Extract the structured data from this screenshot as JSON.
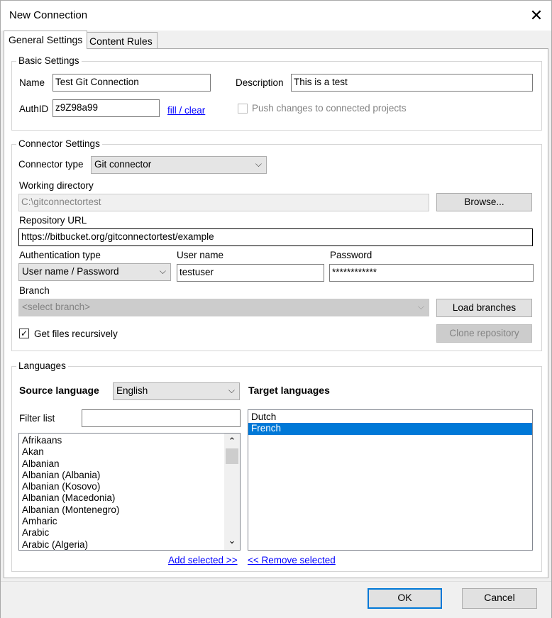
{
  "window": {
    "title": "New Connection",
    "close_glyph": "✕"
  },
  "tabs": [
    {
      "label": "General Settings",
      "active": true
    },
    {
      "label": "Content Rules",
      "active": false
    }
  ],
  "basic": {
    "group_label": "Basic Settings",
    "name_label": "Name",
    "name_value": "Test Git Connection",
    "description_label": "Description",
    "description_value": "This is a test",
    "authid_label": "AuthID",
    "authid_value": "z9Z98a99",
    "fill_clear_link": "fill / clear",
    "push_changes_label": "Push changes to connected projects",
    "push_changes_checked": false
  },
  "connector": {
    "group_label": "Connector Settings",
    "type_label": "Connector type",
    "type_value": "Git connector",
    "workdir_label": "Working directory",
    "workdir_value": "C:\\gitconnectortest",
    "browse_button": "Browse...",
    "repo_label": "Repository URL",
    "repo_value": "https://bitbucket.org/gitconnectortest/example",
    "auth_type_label": "Authentication type",
    "auth_type_value": "User name / Password",
    "username_label": "User name",
    "username_value": "testuser",
    "password_label": "Password",
    "password_value": "************",
    "branch_label": "Branch",
    "branch_value": "<select branch>",
    "load_branches_button": "Load branches",
    "recursive_label": "Get files recursively",
    "recursive_checked": true,
    "clone_button": "Clone repository"
  },
  "languages": {
    "group_label": "Languages",
    "source_label": "Source language",
    "source_value": "English",
    "target_label": "Target languages",
    "filter_label": "Filter list",
    "filter_value": "",
    "source_list": [
      "Afrikaans",
      "Akan",
      "Albanian",
      "Albanian (Albania)",
      "Albanian (Kosovo)",
      "Albanian (Macedonia)",
      "Albanian (Montenegro)",
      "Amharic",
      "Arabic",
      "Arabic (Algeria)"
    ],
    "target_list": [
      "Dutch",
      "French"
    ],
    "target_selected": "French",
    "add_selected_link": "Add selected  >>",
    "remove_selected_link": "<< Remove selected"
  },
  "footer": {
    "ok_button": "OK",
    "cancel_button": "Cancel"
  },
  "icons": {
    "dropdown_arrow": "⌵",
    "check_mark": "✓",
    "scroll_up": "⌃",
    "scroll_down": "⌄"
  },
  "colors": {
    "accent": "#0078d7",
    "link": "#0000ff"
  }
}
